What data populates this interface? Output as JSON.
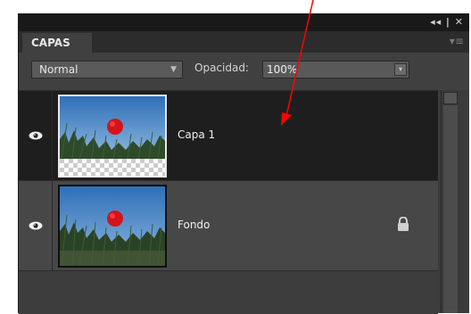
{
  "panel": {
    "titlebar_icons": "◂◂ | ✕",
    "tab_label": "CAPAS",
    "menu_icon": "menu-icon"
  },
  "controls": {
    "blend_mode": "Normal",
    "opacity_label": "Opacidad:",
    "opacity_value": "100%"
  },
  "layers": [
    {
      "name": "Capa 1",
      "visible": true,
      "selected": true,
      "locked": false
    },
    {
      "name": "Fondo",
      "visible": true,
      "selected": false,
      "locked": true
    }
  ],
  "colors": {
    "panel_bg": "#3b3b3b",
    "selected_row": "#1e1e1e",
    "annotation_arrow": "#ff0000"
  }
}
